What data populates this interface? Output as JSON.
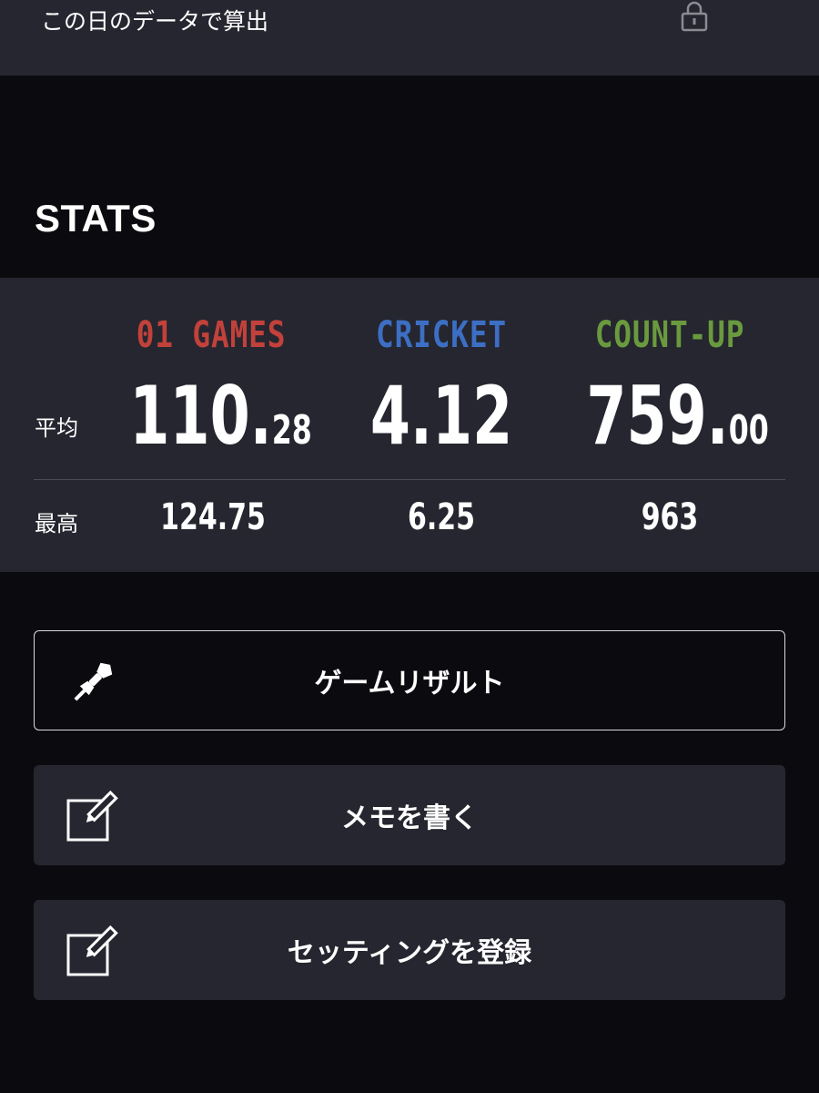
{
  "top": {
    "label": "この日のデータで算出",
    "icon": "lock-icon"
  },
  "stats": {
    "heading": "STATS",
    "columns": [
      {
        "name": "01 GAMES",
        "color": "#c2413b",
        "avg_int": "110",
        "avg_dec": "28",
        "max": "124.75"
      },
      {
        "name": "CRICKET",
        "color": "#3c6fc4",
        "avg_int": "4.12",
        "avg_dec": "",
        "max": "6.25"
      },
      {
        "name": "COUNT-UP",
        "color": "#6a9a3e",
        "avg_int": "759",
        "avg_dec": "00",
        "max": "963"
      }
    ],
    "avg_label": "平均",
    "max_label": "最高"
  },
  "actions": {
    "game_result": {
      "label": "ゲームリザルト",
      "icon": "dart-icon"
    },
    "write_memo": {
      "label": "メモを書く",
      "icon": "edit-icon"
    },
    "register_setting": {
      "label": "セッティングを登録",
      "icon": "edit-icon"
    }
  },
  "colors": {
    "background": "#0b0b0f",
    "panel": "#25262f"
  }
}
